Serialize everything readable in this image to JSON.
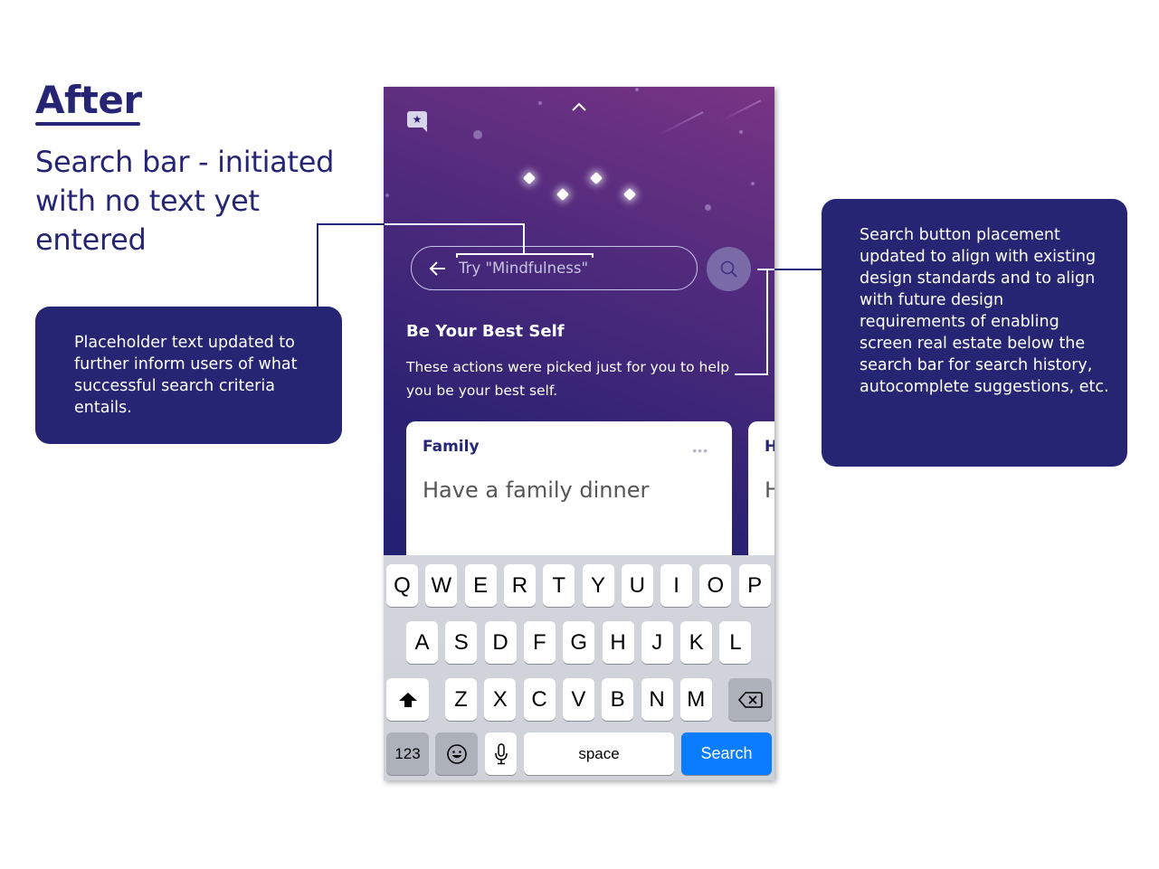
{
  "slide": {
    "heading": "After",
    "subtitle": "Search bar - initiated with no text yet entered",
    "callouts": {
      "placeholder_note": "Placeholder text updated to further inform users of what successful search criteria entails.",
      "search_button_note": "Search button placement updated to align with existing design standards and to align with future design requirements of enabling screen real estate below the search bar for search history, autocomplete suggestions, etc."
    },
    "colors": {
      "brand_navy": "#262574",
      "keyboard_action_blue": "#0a7cff"
    }
  },
  "app": {
    "icons": {
      "top_left": "chat-star-icon",
      "top_center": "chevron-up-icon",
      "search_back": "back-arrow-icon",
      "search_button": "search-icon",
      "card_menu": "more-icon"
    },
    "search": {
      "value": "",
      "placeholder": "Try \"Mindfulness\""
    },
    "section": {
      "title": "Be Your Best Self",
      "description": "These actions were picked just for you to help you be your best self."
    },
    "cards": [
      {
        "category": "Family",
        "title": "Have a family dinner",
        "menu": "•••"
      },
      {
        "category": "H",
        "title": "H"
      }
    ]
  },
  "keyboard": {
    "row1": [
      "Q",
      "W",
      "E",
      "R",
      "T",
      "Y",
      "U",
      "I",
      "O",
      "P"
    ],
    "row2": [
      "A",
      "S",
      "D",
      "F",
      "G",
      "H",
      "J",
      "K",
      "L"
    ],
    "row3": [
      "Z",
      "X",
      "C",
      "V",
      "B",
      "N",
      "M"
    ],
    "numbers_key": "123",
    "space_key": "space",
    "action_key": "Search",
    "icons": {
      "shift": "shift-icon",
      "delete": "backspace-icon",
      "emoji": "emoji-icon",
      "mic": "microphone-icon"
    }
  }
}
